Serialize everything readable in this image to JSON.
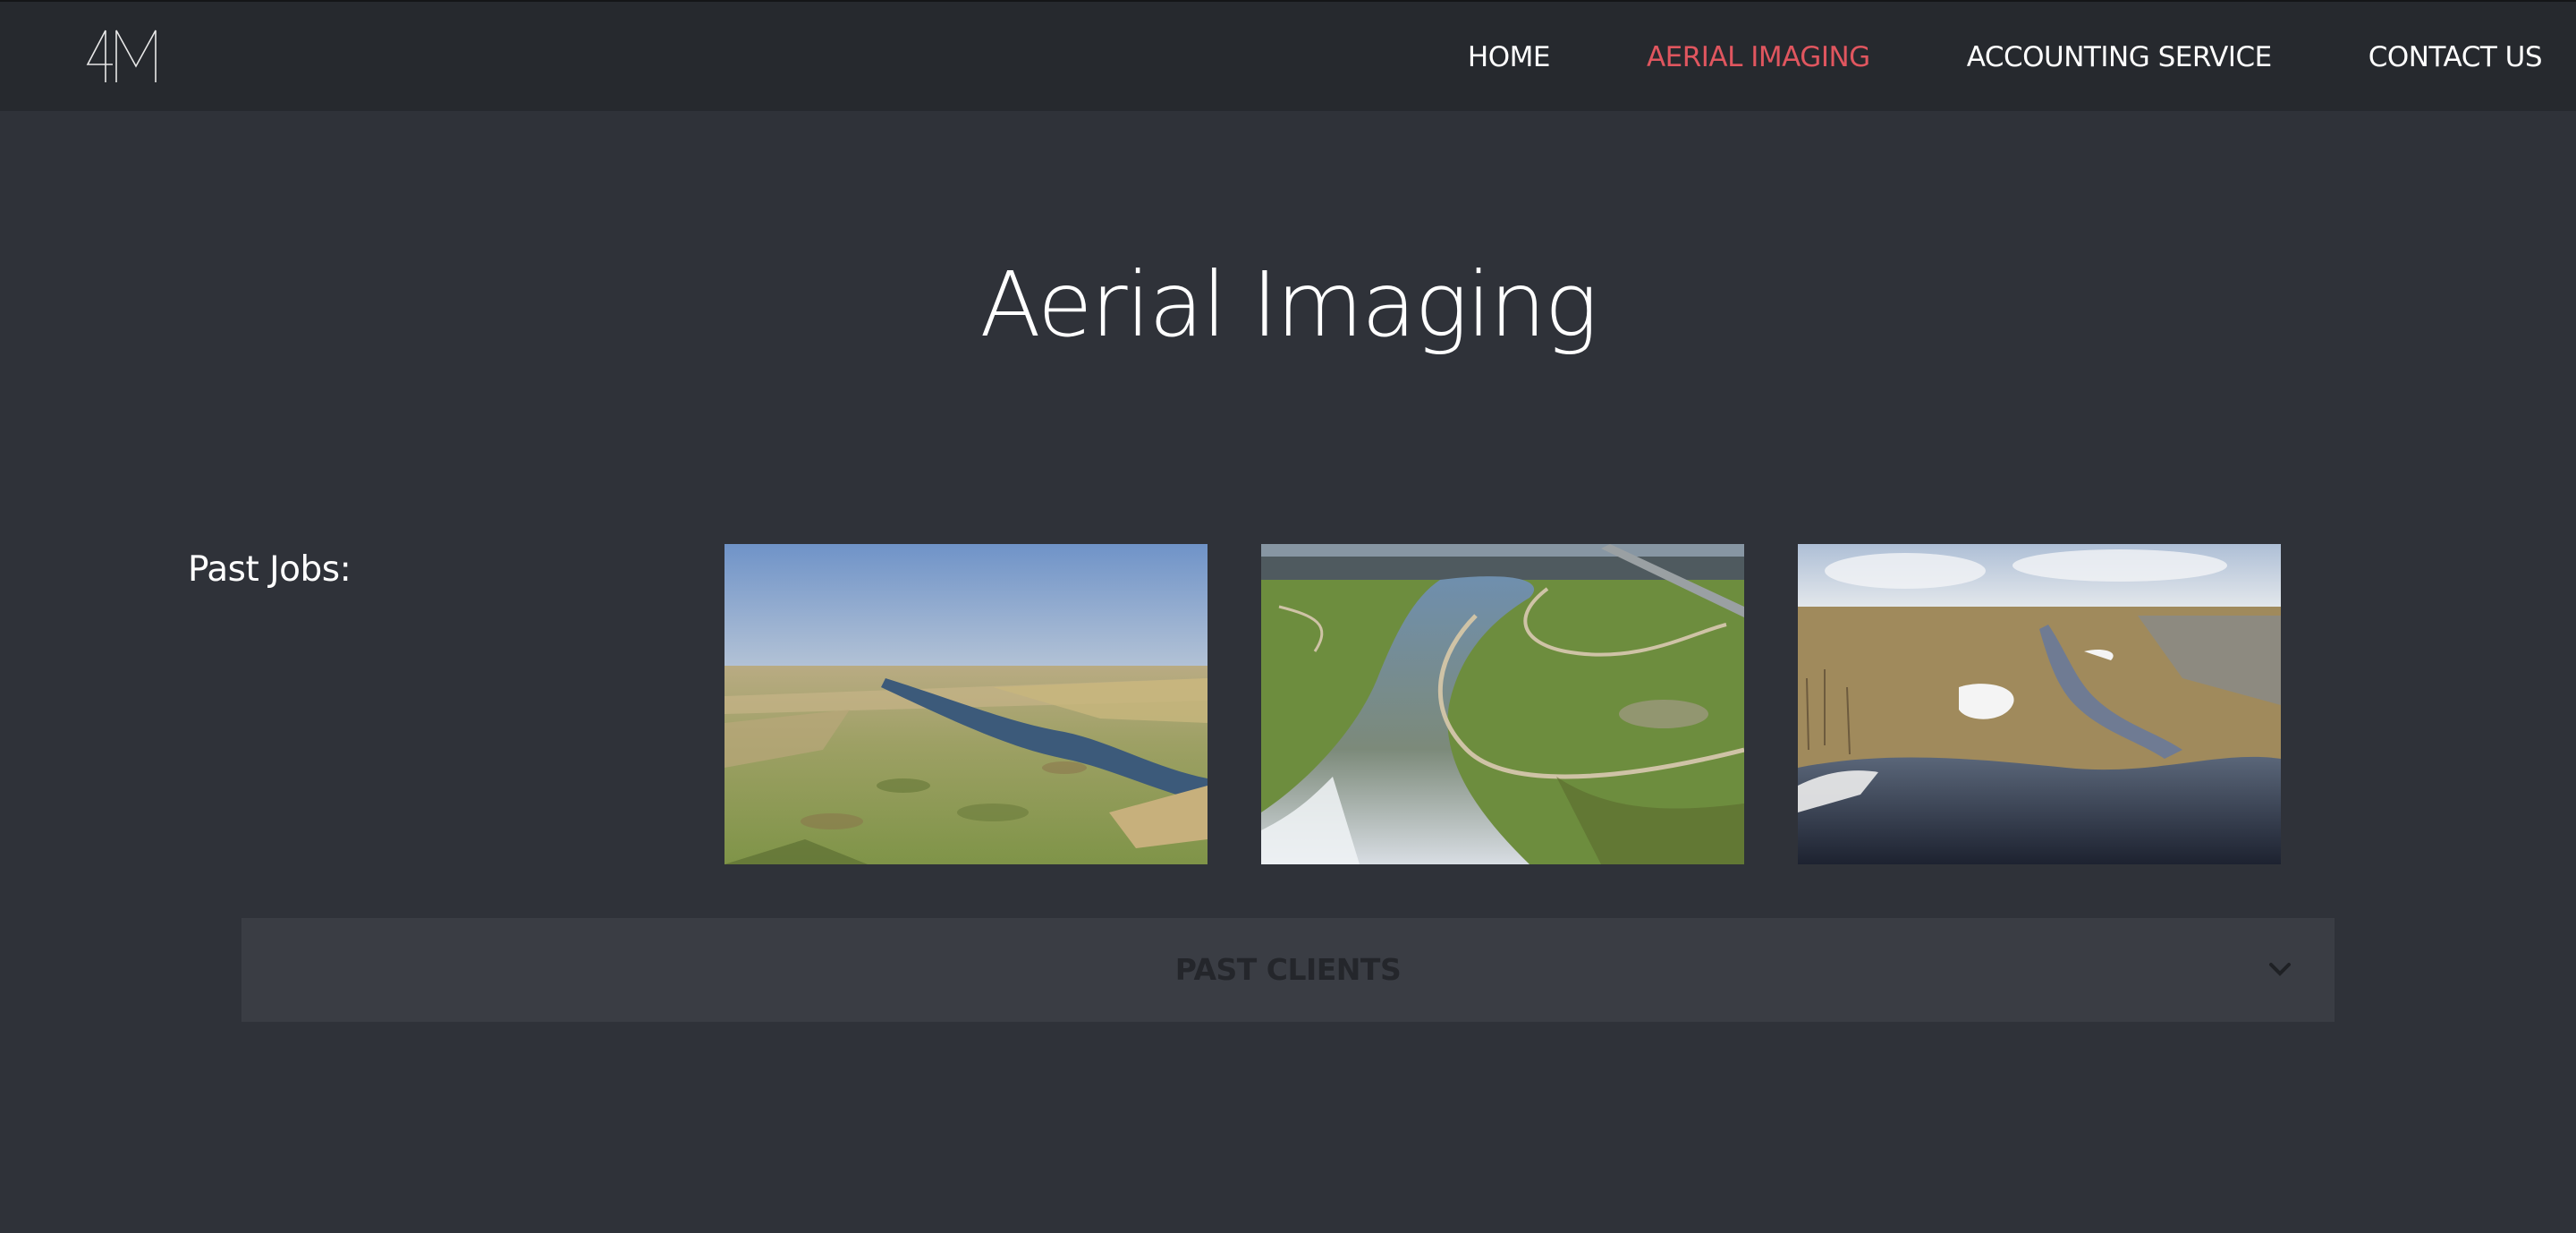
{
  "header": {
    "logo_text": "4M",
    "nav": [
      {
        "label": "HOME",
        "active": false
      },
      {
        "label": "AERIAL IMAGING",
        "active": true
      },
      {
        "label": "ACCOUNTING SERVICE",
        "active": false
      },
      {
        "label": "CONTACT US",
        "active": false
      }
    ]
  },
  "main": {
    "title": "Aerial Imaging",
    "past_jobs_label": "Past Jobs:",
    "photos": [
      {
        "subject": "aerial prairie wetlands with river"
      },
      {
        "subject": "aerial river through park with paths"
      },
      {
        "subject": "aerial spring wetland with snow patches"
      }
    ],
    "accordion": {
      "title": "PAST CLIENTS",
      "icon": "chevron-down-icon"
    }
  },
  "colors": {
    "page_bg": "#2f3239",
    "nav_bg": "#26292e",
    "accent": "#e0565f",
    "accordion_bg": "#3a3d44",
    "accordion_text": "#24262b"
  }
}
